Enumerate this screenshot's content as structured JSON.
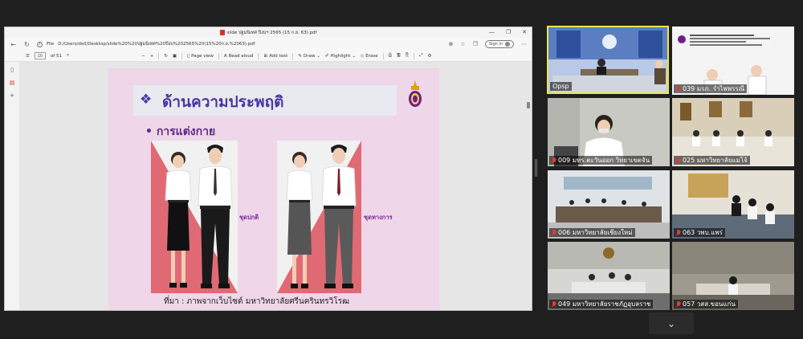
{
  "window": {
    "title": "slide ปฐมนิเทศ ปีงบฯ 2565 (15 ก.ย. 63).pdf",
    "controls": [
      "—",
      "❐",
      "✕"
    ]
  },
  "address": {
    "file_label": "File",
    "url": "D:/Users/dell/Desktop/slide%20%20ปฐมนิเทศ%20ปีงบ%202565%20(15%20ก.ย.%2063).pdf",
    "signin": "Sign in"
  },
  "pdf_toolbar": {
    "page": "10",
    "of": "of 51",
    "page_view": "Page view",
    "read_aloud": "Read aloud",
    "add_text": "Add text",
    "draw": "Draw",
    "highlight": "Highlight",
    "erase": "Erase"
  },
  "slide": {
    "heading_symbol": "❖",
    "heading": "ด้านความประพฤติ",
    "bullet": "• การแต่งกาย",
    "caption_normal": "ชุดปกติ",
    "caption_formal": "ชุดทางการ",
    "source": "ที่มา : ภาพจากเว็บไซต์  มหาวิทยาลัยศรีนครินทรวิโรฒ"
  },
  "participants": [
    {
      "name": "Opsp",
      "muted": false
    },
    {
      "name": "039 มรภ. รำไพพรรณี",
      "muted": true
    },
    {
      "name": "009 มทร.ตะวันออก วิทยาเขตจัน",
      "muted": true
    },
    {
      "name": "025 มหาวิทยาลัยแม่โจ้",
      "muted": true
    },
    {
      "name": "006 มหาวิทยาลัยเชียงใหม่",
      "muted": true
    },
    {
      "name": "063 วพบ.แพร่",
      "muted": true
    },
    {
      "name": "049 มหาวิทยาลัยราชภัฏอุบลราช",
      "muted": true
    },
    {
      "name": "057 วสส.ขอนแก่น",
      "muted": true
    }
  ],
  "colors": {
    "accent_purple": "#4a37a0",
    "slide_bg": "#efd6e8",
    "active_border": "#f2e34c",
    "mute_red": "#e53935"
  },
  "bottom": {
    "collapse_icon": "⌄"
  }
}
